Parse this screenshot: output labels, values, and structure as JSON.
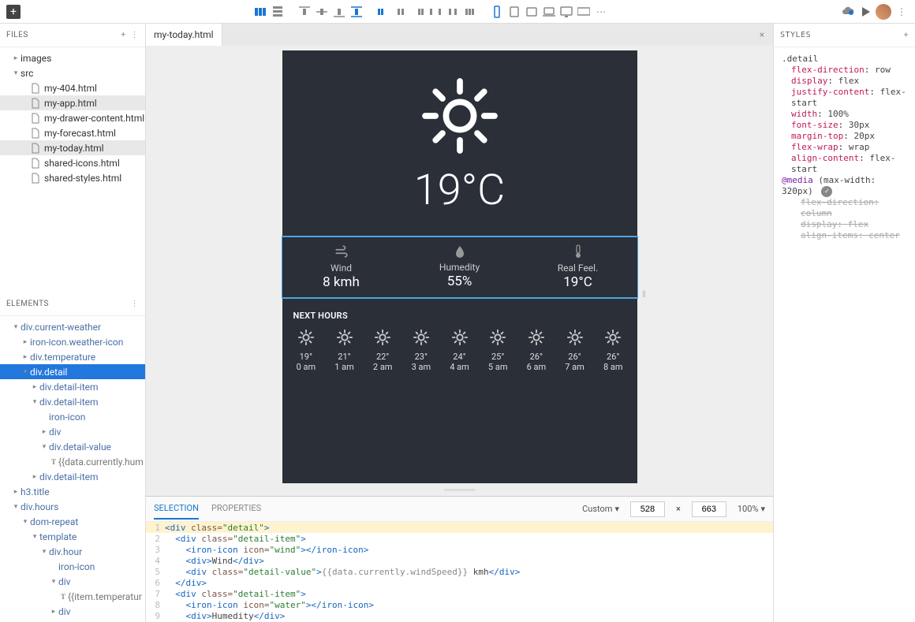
{
  "topbar": {
    "add_label": "+"
  },
  "files": {
    "header": "FILES",
    "items": [
      {
        "name": "images",
        "type": "folder",
        "indent": 0,
        "expand": "▸"
      },
      {
        "name": "src",
        "type": "folder",
        "indent": 0,
        "expand": "▾"
      },
      {
        "name": "my-404.html",
        "type": "file",
        "indent": 1
      },
      {
        "name": "my-app.html",
        "type": "file",
        "indent": 1,
        "selected": true
      },
      {
        "name": "my-drawer-content.html",
        "type": "file",
        "indent": 1
      },
      {
        "name": "my-forecast.html",
        "type": "file",
        "indent": 1
      },
      {
        "name": "my-today.html",
        "type": "file",
        "indent": 1,
        "selected": true
      },
      {
        "name": "shared-icons.html",
        "type": "file",
        "indent": 1
      },
      {
        "name": "shared-styles.html",
        "type": "file",
        "indent": 1
      }
    ]
  },
  "elements": {
    "header": "ELEMENTS",
    "items": [
      {
        "kind": "el",
        "label": "div.current-weather",
        "indent": 0,
        "chev": "▾"
      },
      {
        "kind": "el",
        "label": "iron-icon.weather-icon",
        "indent": 1,
        "chev": "▸"
      },
      {
        "kind": "el",
        "label": "div.temperature",
        "indent": 1,
        "chev": "▸"
      },
      {
        "kind": "el",
        "label": "div.detail",
        "indent": 1,
        "chev": "▾",
        "selected": true
      },
      {
        "kind": "el",
        "label": "div.detail-item",
        "indent": 2,
        "chev": "▸"
      },
      {
        "kind": "el",
        "label": "div.detail-item",
        "indent": 2,
        "chev": "▾"
      },
      {
        "kind": "el",
        "label": "iron-icon",
        "indent": 3,
        "chev": ""
      },
      {
        "kind": "el",
        "label": "div",
        "indent": 3,
        "chev": "▸"
      },
      {
        "kind": "el",
        "label": "div.detail-value",
        "indent": 3,
        "chev": "▾"
      },
      {
        "kind": "text",
        "label": "{{data.currently.hum",
        "indent": 4,
        "chev": "T"
      },
      {
        "kind": "el",
        "label": "div.detail-item",
        "indent": 2,
        "chev": "▸"
      },
      {
        "kind": "el",
        "label": "h3.title",
        "indent": 0,
        "chev": "▸"
      },
      {
        "kind": "el",
        "label": "div.hours",
        "indent": 0,
        "chev": "▾"
      },
      {
        "kind": "el",
        "label": "dom-repeat",
        "indent": 1,
        "chev": "▾"
      },
      {
        "kind": "el",
        "label": "template",
        "indent": 2,
        "chev": "▾"
      },
      {
        "kind": "el",
        "label": "div.hour",
        "indent": 3,
        "chev": "▾"
      },
      {
        "kind": "el",
        "label": "iron-icon",
        "indent": 4,
        "chev": ""
      },
      {
        "kind": "el",
        "label": "div",
        "indent": 4,
        "chev": "▾"
      },
      {
        "kind": "text",
        "label": "{{item.temperatur",
        "indent": 5,
        "chev": "T"
      },
      {
        "kind": "el",
        "label": "div",
        "indent": 4,
        "chev": "▸"
      }
    ]
  },
  "tab": {
    "name": "my-today.html",
    "close": "×"
  },
  "preview": {
    "temp": "19°C",
    "details": [
      {
        "icon": "wind",
        "label": "Wind",
        "value": "8 kmh"
      },
      {
        "icon": "water",
        "label": "Humedity",
        "value": "55%"
      },
      {
        "icon": "thermo",
        "label": "Real Feel.",
        "value": "19°C"
      }
    ],
    "next_title": "NEXT HOURS",
    "hours": [
      {
        "t": "19°",
        "h": "0 am"
      },
      {
        "t": "21°",
        "h": "1 am"
      },
      {
        "t": "22°",
        "h": "2 am"
      },
      {
        "t": "23°",
        "h": "3 am"
      },
      {
        "t": "24°",
        "h": "4 am"
      },
      {
        "t": "25°",
        "h": "5 am"
      },
      {
        "t": "26°",
        "h": "6 am"
      },
      {
        "t": "26°",
        "h": "7 am"
      },
      {
        "t": "26°",
        "h": "8 am"
      }
    ]
  },
  "bottom": {
    "tab_selection": "SELECTION",
    "tab_properties": "PROPERTIES",
    "preset": "Custom",
    "w": "528",
    "x": "×",
    "h": "663",
    "zoom": "100%"
  },
  "code": {
    "lines": [
      {
        "n": 1,
        "hl": true,
        "html": "<span class='tag'>&lt;div</span> <span class='attr'>class=</span><span class='str'>\"detail\"</span><span class='tag'>&gt;</span>"
      },
      {
        "n": 2,
        "html": "  <span class='tag'>&lt;div</span> <span class='attr'>class=</span><span class='str'>\"detail-item\"</span><span class='tag'>&gt;</span>"
      },
      {
        "n": 3,
        "html": "    <span class='tag'>&lt;iron-icon</span> <span class='attr'>icon=</span><span class='str'>\"wind\"</span><span class='tag'>&gt;&lt;/iron-icon&gt;</span>"
      },
      {
        "n": 4,
        "html": "    <span class='tag'>&lt;div&gt;</span><span class='txt'>Wind</span><span class='tag'>&lt;/div&gt;</span>"
      },
      {
        "n": 5,
        "html": "    <span class='tag'>&lt;div</span> <span class='attr'>class=</span><span class='str'>\"detail-value\"</span><span class='tag'>&gt;</span><span class='mustache'>{{data.currently.windSpeed}}</span> <span class='txt'>kmh</span><span class='tag'>&lt;/div&gt;</span>"
      },
      {
        "n": 6,
        "html": "  <span class='tag'>&lt;/div&gt;</span>"
      },
      {
        "n": 7,
        "html": "  <span class='tag'>&lt;div</span> <span class='attr'>class=</span><span class='str'>\"detail-item\"</span><span class='tag'>&gt;</span>"
      },
      {
        "n": 8,
        "html": "    <span class='tag'>&lt;iron-icon</span> <span class='attr'>icon=</span><span class='str'>\"water\"</span><span class='tag'>&gt;&lt;/iron-icon&gt;</span>"
      },
      {
        "n": 9,
        "html": "    <span class='tag'>&lt;div&gt;</span><span class='txt'>Humedity</span><span class='tag'>&lt;/div&gt;</span>"
      }
    ]
  },
  "styles": {
    "header": "STYLES",
    "selector": ".detail",
    "rules": [
      {
        "prop": "flex-direction",
        "val": "row"
      },
      {
        "prop": "display",
        "val": "flex"
      },
      {
        "prop": "justify-content",
        "val": "flex-start"
      },
      {
        "prop": "width",
        "val": "100%"
      },
      {
        "prop": "font-size",
        "val": "30px"
      },
      {
        "prop": "margin-top",
        "val": "20px"
      },
      {
        "prop": "flex-wrap",
        "val": "wrap"
      },
      {
        "prop": "align-content",
        "val": "flex-start"
      }
    ],
    "media": "@media (max-width: 320px)",
    "media_rules": [
      {
        "prop": "flex-direction",
        "val": "column"
      },
      {
        "prop": "display",
        "val": "flex"
      },
      {
        "prop": "align-items",
        "val": "center"
      }
    ]
  }
}
